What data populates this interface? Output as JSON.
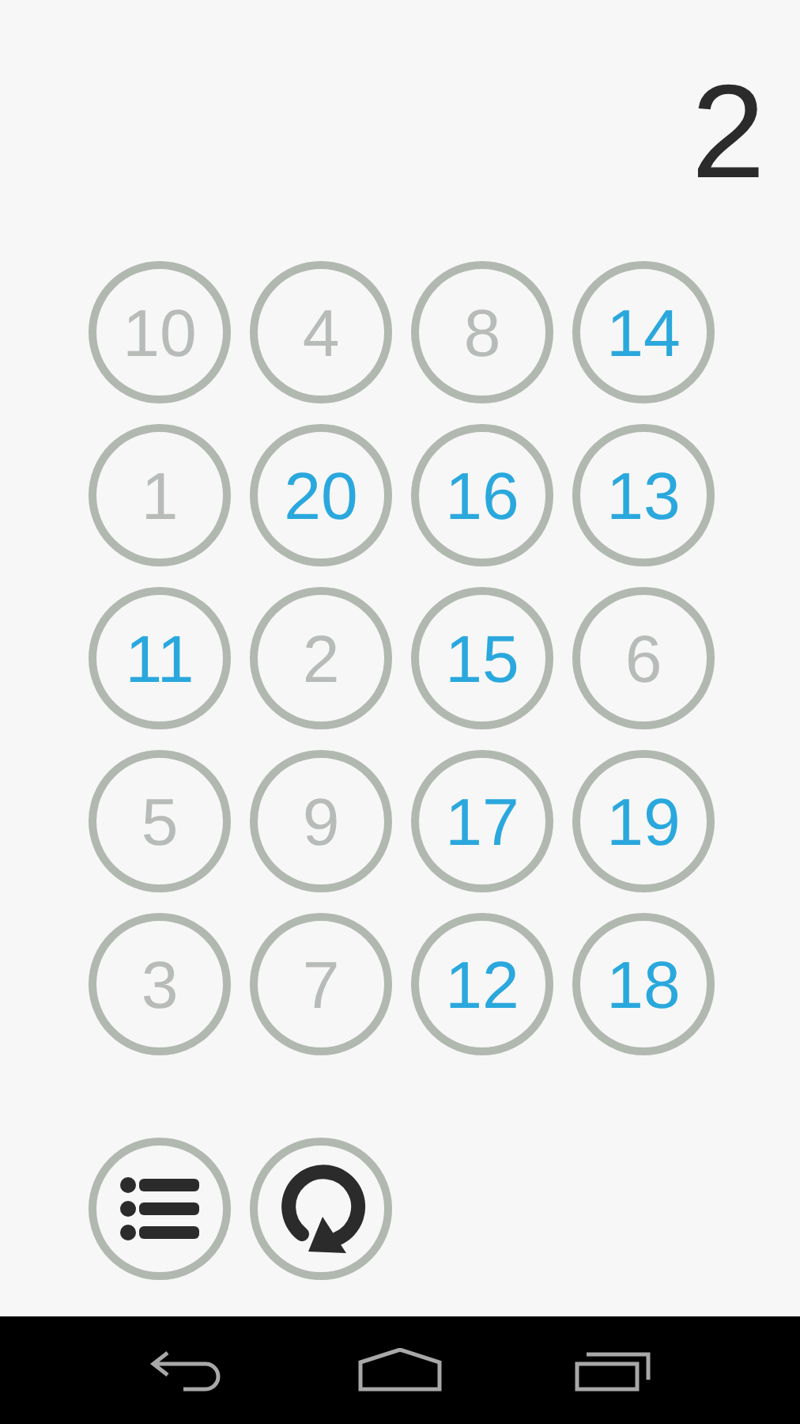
{
  "score": "2",
  "tiles": [
    {
      "label": "10",
      "highlighted": false
    },
    {
      "label": "4",
      "highlighted": false
    },
    {
      "label": "8",
      "highlighted": false
    },
    {
      "label": "14",
      "highlighted": true
    },
    {
      "label": "1",
      "highlighted": false
    },
    {
      "label": "20",
      "highlighted": true
    },
    {
      "label": "16",
      "highlighted": true
    },
    {
      "label": "13",
      "highlighted": true
    },
    {
      "label": "11",
      "highlighted": true
    },
    {
      "label": "2",
      "highlighted": false
    },
    {
      "label": "15",
      "highlighted": true
    },
    {
      "label": "6",
      "highlighted": false
    },
    {
      "label": "5",
      "highlighted": false
    },
    {
      "label": "9",
      "highlighted": false
    },
    {
      "label": "17",
      "highlighted": true
    },
    {
      "label": "19",
      "highlighted": true
    },
    {
      "label": "3",
      "highlighted": false
    },
    {
      "label": "7",
      "highlighted": false
    },
    {
      "label": "12",
      "highlighted": true
    },
    {
      "label": "18",
      "highlighted": true
    }
  ],
  "actions": [
    {
      "kind": "list"
    },
    {
      "kind": "restart"
    }
  ],
  "nav_bar": [
    {
      "kind": "back"
    },
    {
      "kind": "home"
    },
    {
      "kind": "recents"
    }
  ]
}
